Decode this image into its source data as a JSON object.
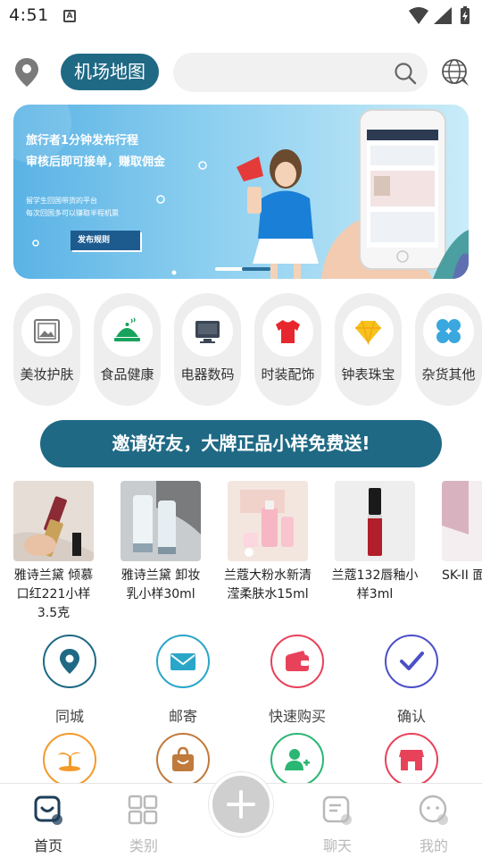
{
  "status_bar": {
    "time": "4:51",
    "notification_icon": "a-box-icon",
    "icons": [
      "wifi-icon",
      "signal-icon",
      "battery-charging-icon"
    ]
  },
  "header": {
    "location_icon": "location-pin-icon",
    "airport_map_label": "机场地图",
    "search_placeholder": "",
    "search_icon": "search-icon",
    "language_icon": "globe-chat-icon"
  },
  "banner": {
    "line1": "旅行者1分钟发布行程",
    "line2": "审核后即可接单，赚取佣金",
    "sub1": "留学生回国带货的平台",
    "sub2": "每次回国多可以赚取半程机票",
    "button_label": "发布规则",
    "page_count": 2,
    "active_page": 1
  },
  "categories": [
    {
      "label": "美妆护肤",
      "icon": "photo-frame-icon"
    },
    {
      "label": "食品健康",
      "icon": "food-cloche-icon"
    },
    {
      "label": "电器数码",
      "icon": "monitor-icon"
    },
    {
      "label": "时装配饰",
      "icon": "tshirt-icon"
    },
    {
      "label": "钟表珠宝",
      "icon": "diamond-icon"
    },
    {
      "label": "杂货其他",
      "icon": "clover-icon"
    }
  ],
  "invite_label": "邀请好友，大牌正品小样免费送!",
  "products": [
    {
      "name": "雅诗兰黛 倾慕口红221小样3.5克"
    },
    {
      "name": "雅诗兰黛 卸妆乳小样30ml"
    },
    {
      "name": "兰蔻大粉水新清滢柔肤水15ml"
    },
    {
      "name": "兰蔻132唇釉小样3ml"
    },
    {
      "name": "SK-II 面"
    }
  ],
  "services_row1": [
    {
      "label": "同城",
      "icon": "location-pin-icon",
      "color": "#1f6985"
    },
    {
      "label": "邮寄",
      "icon": "envelope-icon",
      "color": "#2aa6c8"
    },
    {
      "label": "快速购买",
      "icon": "wallet-icon",
      "color": "#e8425a"
    },
    {
      "label": "确认",
      "icon": "checkmark-icon",
      "color": "#4b4fc8"
    }
  ],
  "services_row2": [
    {
      "label": "",
      "icon": "palm-island-icon",
      "color": "#f39a2a"
    },
    {
      "label": "",
      "icon": "shopping-bag-icon",
      "color": "#c07a3c"
    },
    {
      "label": "",
      "icon": "add-user-icon",
      "color": "#2bb673"
    },
    {
      "label": "",
      "icon": "store-icon",
      "color": "#e8425a"
    }
  ],
  "bottom_nav": [
    {
      "label": "首页",
      "icon": "home-icon",
      "active": true
    },
    {
      "label": "类别",
      "icon": "grid-icon",
      "active": false
    },
    {
      "label": "",
      "icon": "plus-icon",
      "active": false
    },
    {
      "label": "聊天",
      "icon": "chat-icon",
      "active": false
    },
    {
      "label": "我的",
      "icon": "profile-icon",
      "active": false
    }
  ],
  "colors": {
    "primary": "#1f6985",
    "inactive": "#b9b9b9",
    "active_text": "#333333"
  }
}
